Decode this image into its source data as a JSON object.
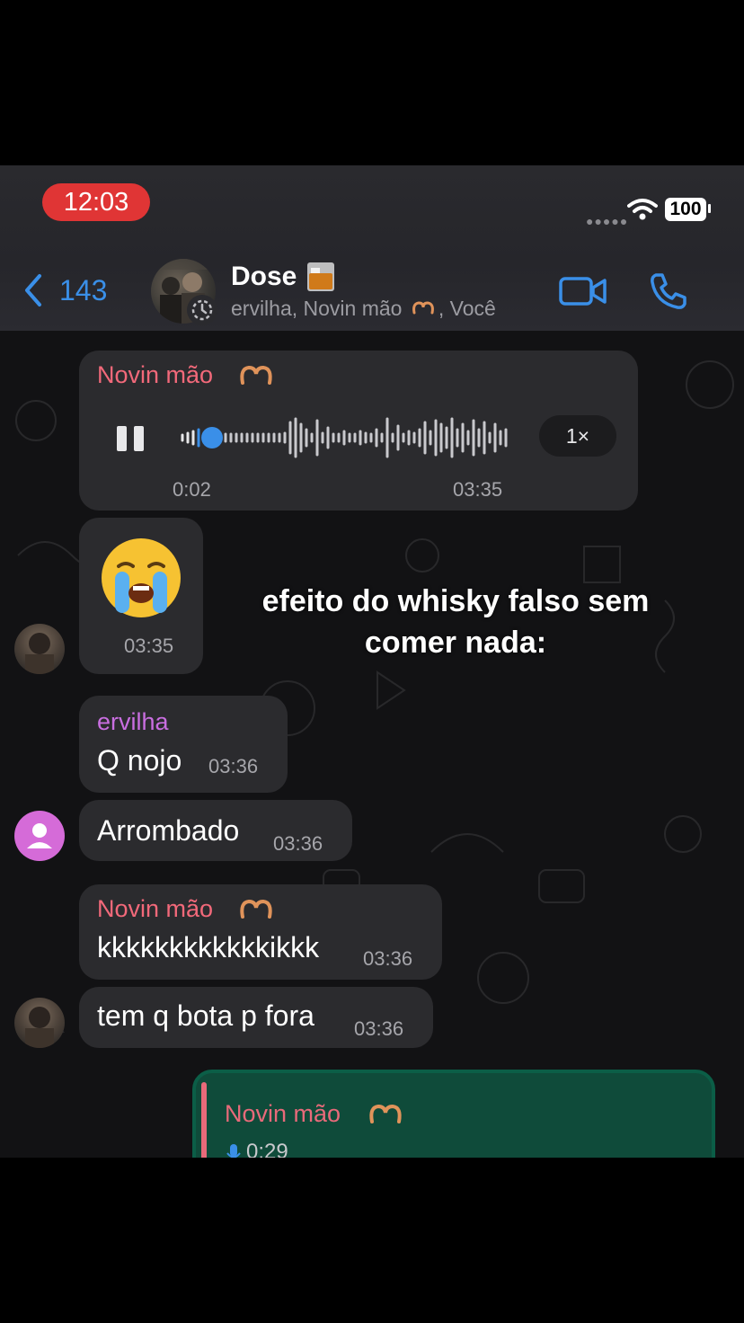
{
  "status_bar": {
    "time": "12:03",
    "battery": "100"
  },
  "header": {
    "back_count": "143",
    "title": "Dose",
    "subtitle_part1": "ervilha, Novin mão",
    "subtitle_part2": ", Você"
  },
  "messages": [
    {
      "sender": "Novin mão",
      "type": "voice",
      "elapsed": "0:02",
      "time": "03:35",
      "speed": "1×",
      "progress": 0.07
    },
    {
      "type": "emoji",
      "emoji": "😭",
      "time": "03:35"
    },
    {
      "sender": "ervilha",
      "text": "Q nojo",
      "time": "03:36"
    },
    {
      "text": "Arrombado",
      "time": "03:36"
    },
    {
      "sender": "Novin mão",
      "text": "kkkkkkkkkkkkikkk",
      "time": "03:36"
    },
    {
      "text": "tem q bota p fora",
      "time": "03:36"
    }
  ],
  "outgoing_reply": {
    "sender": "Novin mão",
    "duration": "0:29"
  },
  "caption": "efeito do whisky falso sem comer nada:",
  "colors": {
    "accent": "#3a8fe8",
    "sender_pink": "#f2697a",
    "sender_purple": "#c96ee0",
    "bubble": "#2b2b2e",
    "outgoing": "#0f4b3a"
  }
}
